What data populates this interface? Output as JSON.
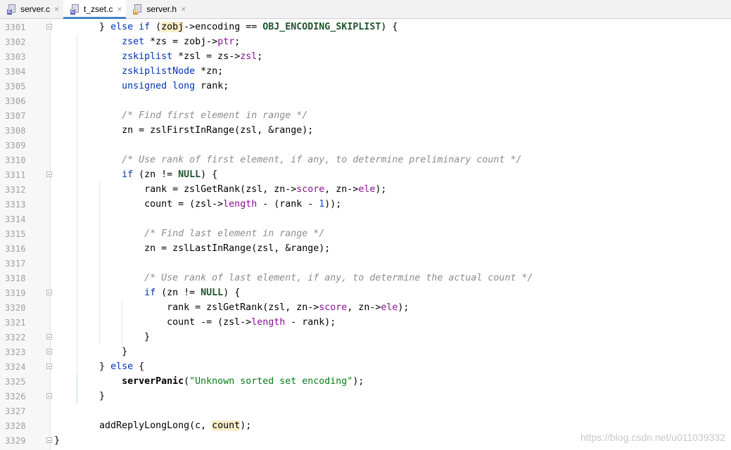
{
  "tabs": [
    {
      "label": "server.c",
      "badge": "C",
      "color": "#6a5acd",
      "active": false
    },
    {
      "label": "t_zset.c",
      "badge": "C",
      "color": "#6a5acd",
      "active": true
    },
    {
      "label": "server.h",
      "badge": "H",
      "color": "#e6a23c",
      "active": false
    }
  ],
  "close_glyph": "×",
  "line_numbers": [
    "3301",
    "3302",
    "3303",
    "3304",
    "3305",
    "3306",
    "3307",
    "3308",
    "3309",
    "3310",
    "3311",
    "3312",
    "3313",
    "3314",
    "3315",
    "3316",
    "3317",
    "3318",
    "3319",
    "3320",
    "3321",
    "3322",
    "3323",
    "3324",
    "3325",
    "3326",
    "3327",
    "3328",
    "3329"
  ],
  "code": {
    "l1_a": "} ",
    "l1_else": "else",
    "l1_b": " ",
    "l1_if": "if",
    "l1_c": " (",
    "l1_zobj": "zobj",
    "l1_d": "->encoding == ",
    "l1_macro": "OBJ_ENCODING_SKIPLIST",
    "l1_e": ") {",
    "l2_type": "zset",
    "l2_a": " *zs = zobj->",
    "l2_fld": "ptr",
    "l2_b": ";",
    "l3_type": "zskiplist",
    "l3_a": " *zsl = zs->",
    "l3_fld": "zsl",
    "l3_b": ";",
    "l4_type": "zskiplistNode",
    "l4_a": " *zn;",
    "l5_kw1": "unsigned",
    "l5_sp": " ",
    "l5_kw2": "long",
    "l5_a": " rank;",
    "l7_cm": "/* Find first element in range */",
    "l8": "zn = zslFirstInRange(zsl, &range);",
    "l10_cm": "/* Use rank of first element, if any, to determine preliminary count */",
    "l11_if": "if",
    "l11_a": " (zn != ",
    "l11_null": "NULL",
    "l11_b": ") {",
    "l12_a": "rank = zslGetRank(zsl, zn->",
    "l12_f1": "score",
    "l12_b": ", zn->",
    "l12_f2": "ele",
    "l12_c": ");",
    "l13_a": "count = (zsl->",
    "l13_f": "length",
    "l13_b": " - (rank - ",
    "l13_n": "1",
    "l13_c": "));",
    "l15_cm": "/* Find last element in range */",
    "l16": "zn = zslLastInRange(zsl, &range);",
    "l18_cm": "/* Use rank of last element, if any, to determine the actual count */",
    "l19_if": "if",
    "l19_a": " (zn != ",
    "l19_null": "NULL",
    "l19_b": ") {",
    "l20_a": "rank = zslGetRank(zsl, zn->",
    "l20_f1": "score",
    "l20_b": ", zn->",
    "l20_f2": "ele",
    "l20_c": ");",
    "l21_a": "count -= (zsl->",
    "l21_f": "length",
    "l21_b": " - rank);",
    "l22": "}",
    "l23": "}",
    "l24_a": "} ",
    "l24_else": "else",
    "l24_b": " {",
    "l25_fn": "serverPanic",
    "l25_a": "(",
    "l25_str": "\"Unknown sorted set encoding\"",
    "l25_b": ");",
    "l26": "}",
    "l28_a": "addReplyLongLong(c, ",
    "l28_count": "count",
    "l28_b": ");",
    "l29": "}"
  },
  "watermark": "https://blog.csdn.net/u011039332"
}
